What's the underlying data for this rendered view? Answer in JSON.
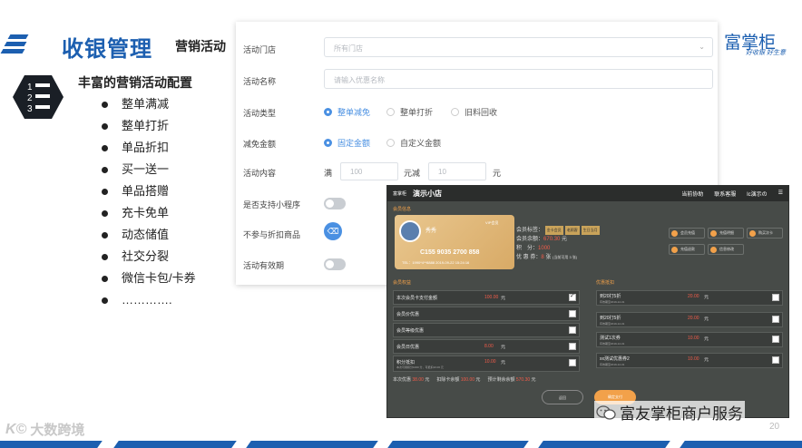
{
  "header": {
    "title": "收银管理",
    "subtitle": "营销活动"
  },
  "features": {
    "title": "丰富的营销活动配置",
    "icon_numbers": [
      "1",
      "2",
      "3"
    ],
    "items": [
      "整单满减",
      "整单打折",
      "单品折扣",
      "买一送一",
      "单品搭赠",
      "充卡免单",
      "动态储值",
      "社交分裂",
      "微信卡包/卡券",
      "…………."
    ]
  },
  "form": {
    "store_label": "活动门店",
    "store_placeholder": "所有门店",
    "name_label": "活动名称",
    "name_placeholder": "请输入优惠名称",
    "type_label": "活动类型",
    "type_options": [
      "整单减免",
      "整单打折",
      "旧料回收"
    ],
    "type_selected": "整单减免",
    "amount_label": "减免金额",
    "amount_options": [
      "固定金额",
      "自定义金额"
    ],
    "amount_selected": "固定金额",
    "content_label": "活动内容",
    "content_full": "满",
    "content_full_value": "100",
    "content_reduce": "元减",
    "content_reduce_value": "10",
    "content_unit": "元",
    "miniprogram_label": "是否支持小程序",
    "miniprogram_on": false,
    "exclude_label": "不参与折扣商品",
    "upload_icon": "trash-icon",
    "period_label": "活动有效期",
    "period_on": false
  },
  "brand": {
    "name": "富掌柜",
    "tagline": "好收银 好生意"
  },
  "pos": {
    "logo": "富掌柜",
    "store": "演示小店",
    "nav": [
      "当前协助",
      "联系客服",
      "lc演示の"
    ],
    "member_section": "会员信息",
    "member_card": {
      "name": "秀秀",
      "level": "VIP会员",
      "phone": "C155 9035 2700 858",
      "sub": "TEL：1990*4**8888     2019-09-22 15:24:16"
    },
    "member_info": {
      "tags_label": "会员标签：",
      "tags": [
        "金卡会员",
        "老顾客",
        "生日当月"
      ],
      "balance_label": "会员余额：",
      "balance": "670.30",
      "balance_unit": "元",
      "points_label": "积　分：",
      "points": "1000",
      "coupon_label": "优 惠 券：",
      "coupon_count": "8",
      "coupon_unit": "张",
      "coupon_note": "(当前可用 3 张)"
    },
    "actions": [
      "会员充值",
      "充值明细",
      "购买次卡",
      "充值退款",
      "信息修改"
    ],
    "discount_section": "会员权益",
    "discounts": [
      {
        "label": "本次会员卡支付金额",
        "amount": "100.00",
        "unit": "元",
        "checked": true
      },
      {
        "label": "会员价优惠",
        "amount": "",
        "unit": "",
        "checked": false
      },
      {
        "label": "会员等级优惠",
        "amount": "",
        "unit": "",
        "checked": false
      },
      {
        "label": "会员日优惠",
        "amount": "8.00",
        "unit": "元",
        "checked": false
      },
      {
        "label": "积分抵扣",
        "amount": "10.00",
        "unit": "元",
        "sub": "本次可用积分1000 分，可抵扣10.00 元",
        "checked": false
      }
    ],
    "coupon_section": "优惠抵扣",
    "coupons": [
      {
        "label": "到20打5折",
        "sub": "有效期至2019-12-31",
        "amount": "20.00",
        "unit": "元"
      },
      {
        "label": "到20打5折",
        "sub": "有效期至2019-12-31",
        "amount": "20.00",
        "unit": "元"
      },
      {
        "label": "测试1次券",
        "sub": "有效期至2019-12-31",
        "amount": "10.00",
        "unit": "元"
      },
      {
        "label": "xx测试优惠券2",
        "sub": "有效期至2019-12-31",
        "amount": "10.00",
        "unit": "元"
      }
    ],
    "summary": {
      "discount_label": "本次优惠",
      "discount": "38.00",
      "discount_unit": "元",
      "card_label": "扣除卡余额",
      "card": "100.00",
      "card_unit": "元",
      "remain_label": "预计剩余余额",
      "remain": "570.30",
      "remain_unit": "元"
    },
    "btn_back": "返回",
    "btn_pay": "确定支付"
  },
  "watermark": "富友掌柜商户服务",
  "page_number": "20",
  "footer_text": "大数跨境",
  "footer_logo": "K©"
}
